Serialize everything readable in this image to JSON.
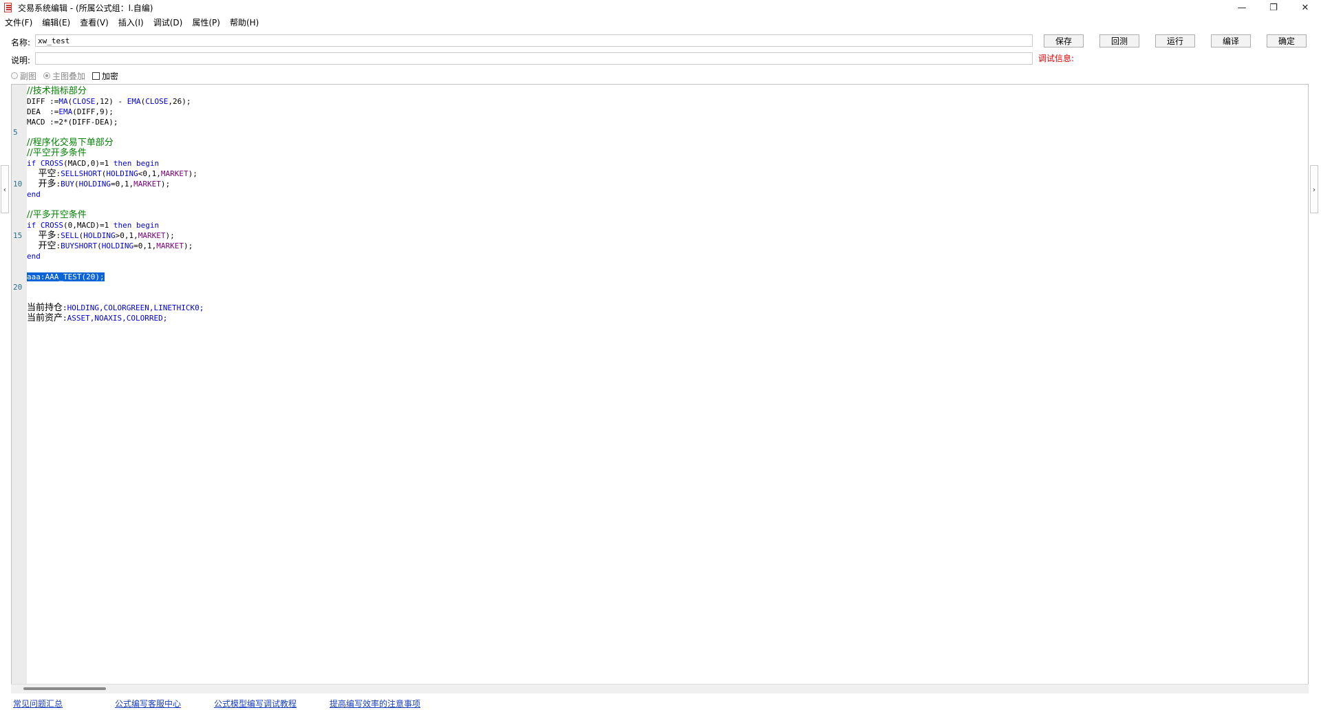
{
  "window": {
    "title": "交易系统编辑 - (所属公式组：l.自编)",
    "minimize": "—",
    "maximize": "❐",
    "close": "✕"
  },
  "menu": [
    "文件(F)",
    "编辑(E)",
    "查看(V)",
    "插入(I)",
    "调试(D)",
    "属性(P)",
    "帮助(H)"
  ],
  "form": {
    "name_label": "名称:",
    "name_value": "xw_test",
    "desc_label": "说明:",
    "desc_value": "",
    "debug_label": "调试信息:"
  },
  "buttons": {
    "save": "保存",
    "backtest": "回测",
    "run": "运行",
    "compile": "编译",
    "ok": "确定"
  },
  "options": {
    "subchart": "副图",
    "overlay": "主图叠加",
    "encrypt": "加密"
  },
  "code": {
    "line_numbers": [
      "5",
      "10",
      "15",
      "20"
    ],
    "l1": "//技术指标部分",
    "l2a": "DIFF :=",
    "l2b": "MA",
    "l2c": "(",
    "l2d": "CLOSE",
    "l2e": ",12) - ",
    "l2f": "EMA",
    "l2g": "(",
    "l2h": "CLOSE",
    "l2i": ",26);",
    "l3a": "DEA  :=",
    "l3b": "EMA",
    "l3c": "(DIFF,9);",
    "l4": "MACD :=2*(DIFF-DEA);",
    "l6": "//程序化交易下单部分",
    "l7": "//平空开多条件",
    "l8a": "if ",
    "l8b": "CROSS",
    "l8c": "(MACD,0)=1 ",
    "l8d": "then begin",
    "l9a": "    平空",
    "l9b": ":",
    "l9c": "SELLSHORT",
    "l9d": "(",
    "l9e": "HOLDING",
    "l9f": "<0,1,",
    "l9g": "MARKET",
    "l9h": ");",
    "l10a": "    开多",
    "l10b": ":",
    "l10c": "BUY",
    "l10d": "(",
    "l10e": "HOLDING",
    "l10f": "=0,1,",
    "l10g": "MARKET",
    "l10h": ");",
    "l11": "end",
    "l13": "//平多开空条件",
    "l14a": "if ",
    "l14b": "CROSS",
    "l14c": "(0,MACD)=1 ",
    "l14d": "then begin",
    "l15a": "    平多",
    "l15b": ":",
    "l15c": "SELL",
    "l15d": "(",
    "l15e": "HOLDING",
    "l15f": ">0,1,",
    "l15g": "MARKET",
    "l15h": ");",
    "l16a": "    开空",
    "l16b": ":",
    "l16c": "BUYSHORT",
    "l16d": "(",
    "l16e": "HOLDING",
    "l16f": "=0,1,",
    "l16g": "MARKET",
    "l16h": ");",
    "l17": "end",
    "l19": "aaa:AAA_TEST(20);",
    "l22a": "当前持仓",
    "l22b": ":",
    "l22c": "HOLDING,COLORGREEN,LINETHICK0;",
    "l23a": "当前资产",
    "l23b": ":",
    "l23c": "ASSET,NOAXIS,COLORRED;"
  },
  "footer_links": [
    "常见问题汇总",
    "公式编写客服中心",
    "公式模型编写调试教程",
    "提高编写效率的注意事项"
  ],
  "colors": {
    "comment": "#008000",
    "keyword": "#0000e0",
    "constant": "#7a007a",
    "selection": "#0a64d8",
    "debug": "#e00000",
    "link": "#1a3fbf"
  }
}
